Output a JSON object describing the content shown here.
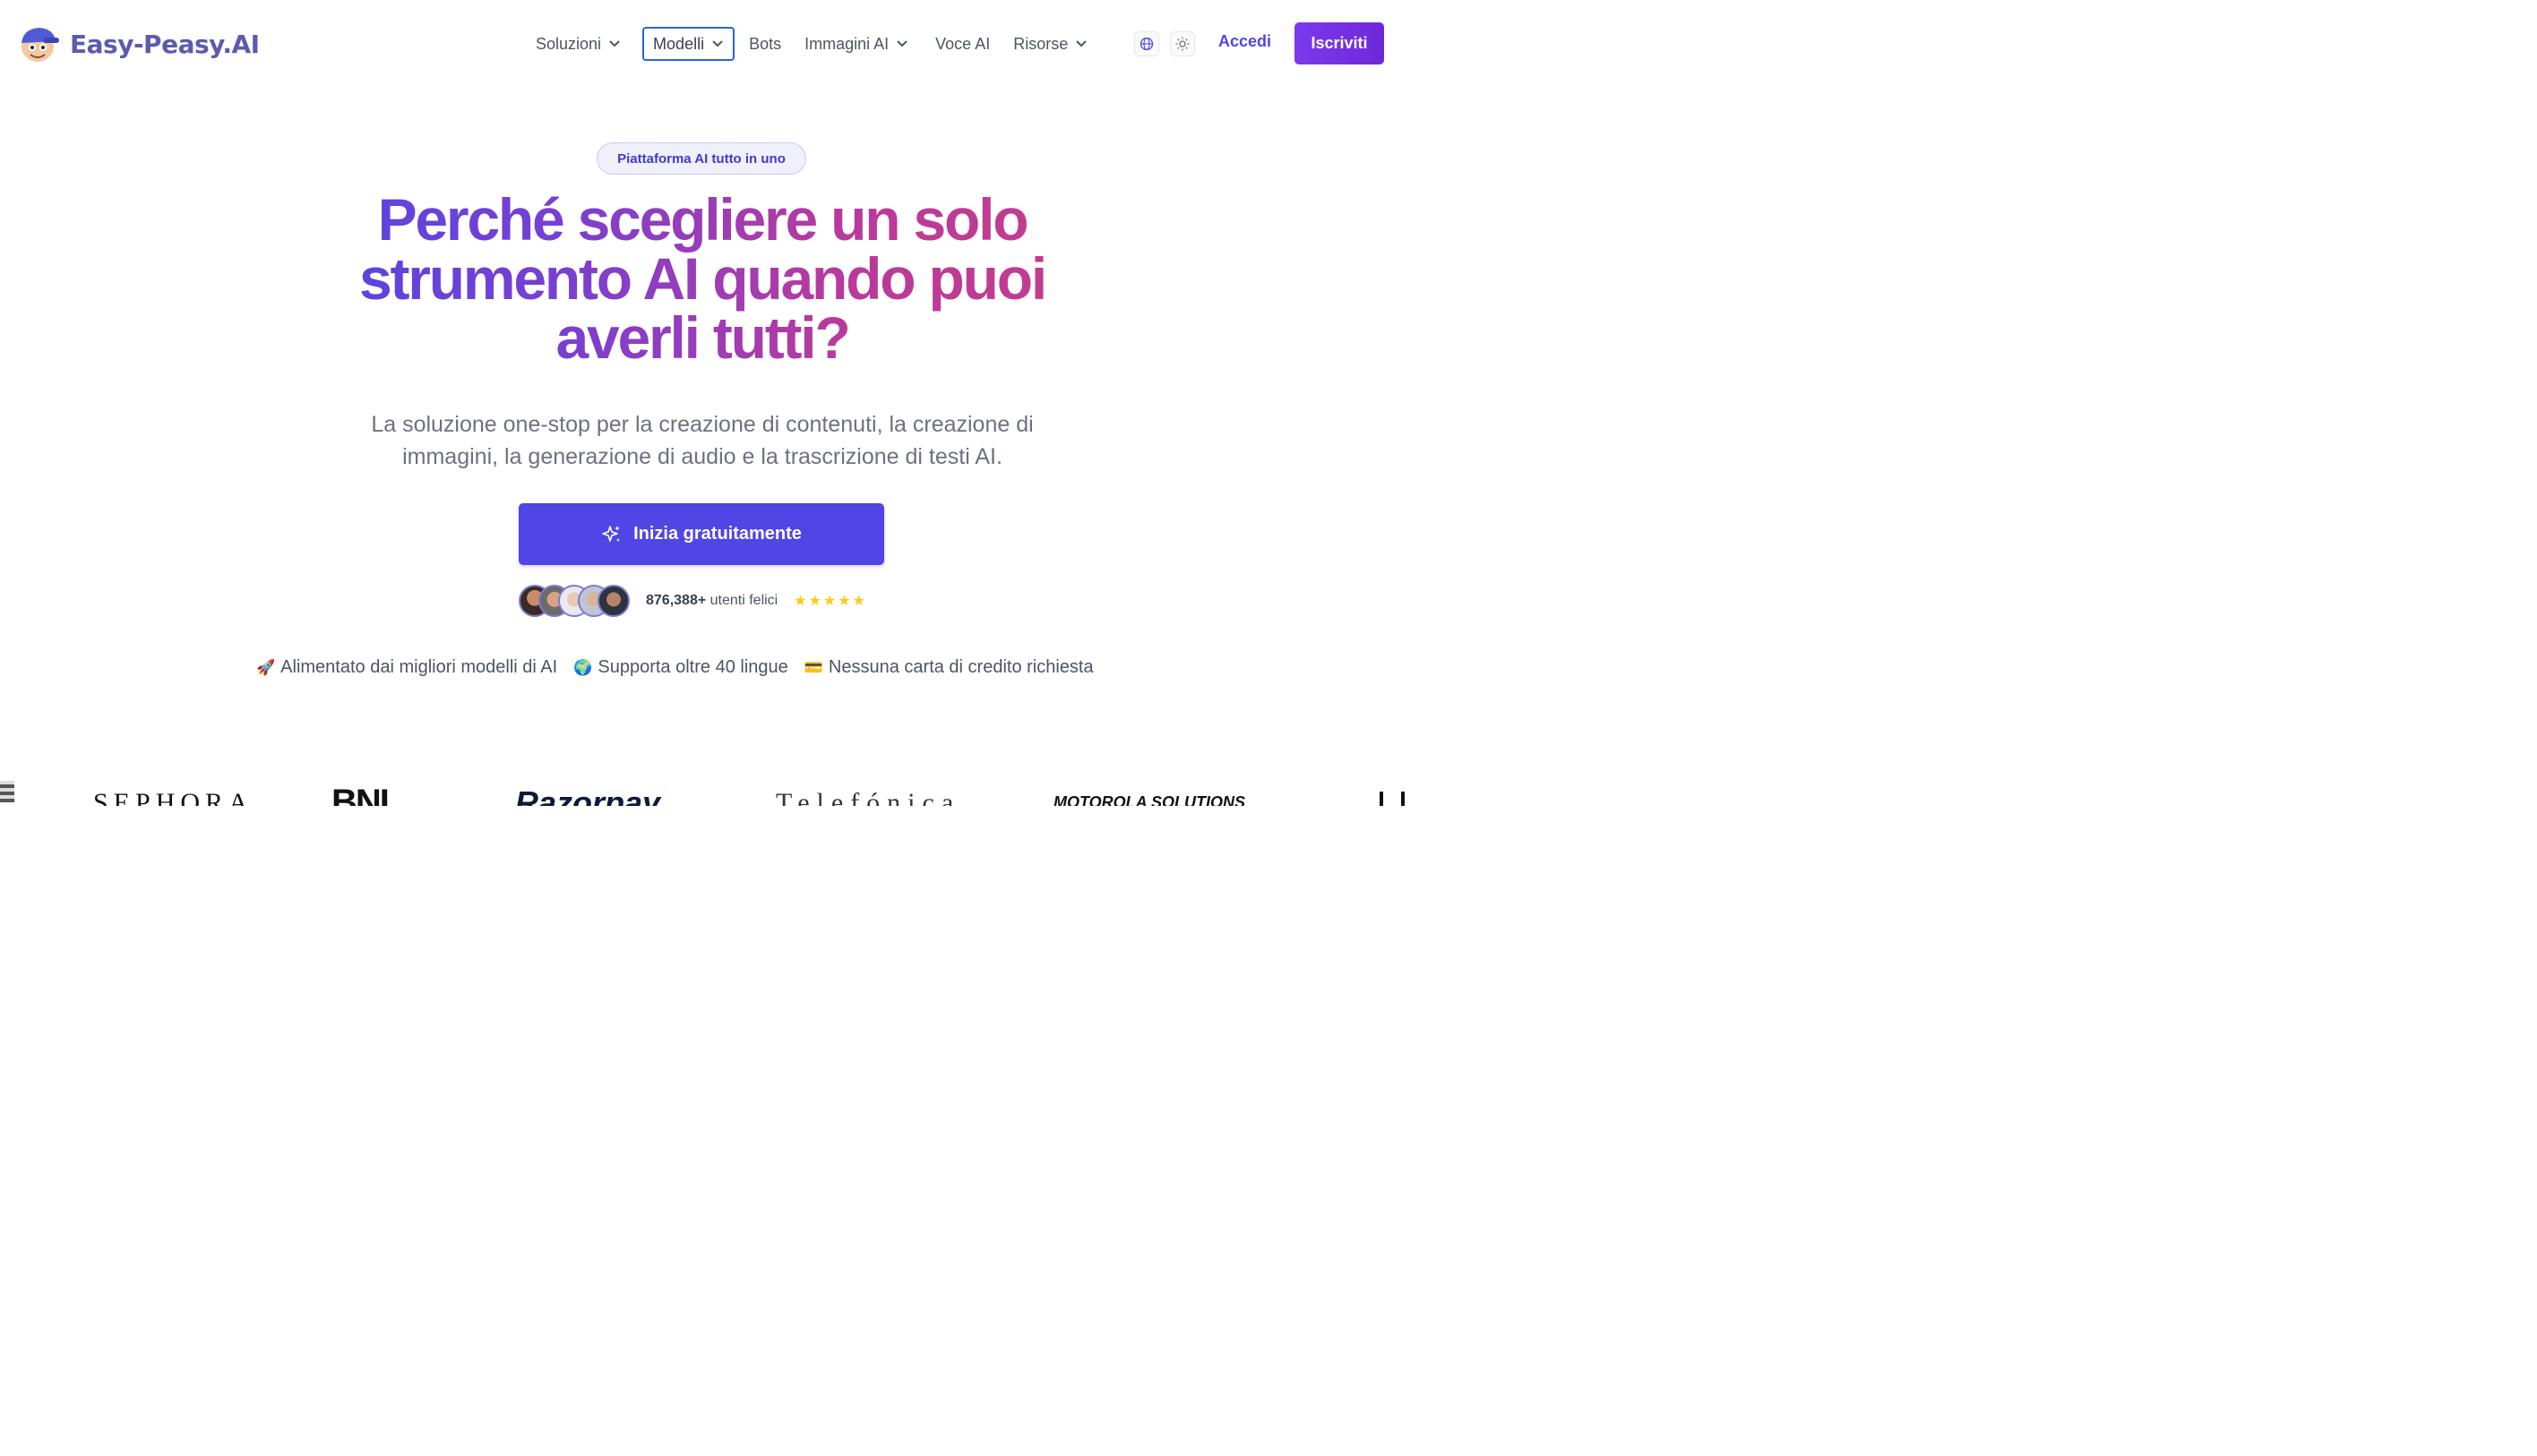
{
  "brand": {
    "name": "Easy-Peasy.AI"
  },
  "nav": {
    "items": [
      {
        "label": "Soluzioni",
        "has_dropdown": true
      },
      {
        "label": "Modelli",
        "has_dropdown": true,
        "focused": true
      },
      {
        "label": "Bots",
        "has_dropdown": false
      },
      {
        "label": "Immagini AI",
        "has_dropdown": true
      },
      {
        "label": "Voce AI",
        "has_dropdown": false
      },
      {
        "label": "Risorse",
        "has_dropdown": true
      }
    ],
    "chevron_glyph": "⌄",
    "language_icon": "globe-icon",
    "theme_icon": "sun-icon",
    "login_label": "Accedi",
    "signup_label": "Iscriviti"
  },
  "hero": {
    "badge": "Piattaforma AI tutto in uno",
    "headline_line1": "Perché scegliere un solo",
    "headline_line2": "strumento AI quando puoi",
    "headline_line3": "averli tutti?",
    "subtitle_line1": "La soluzione one-stop per la creazione di contenuti, la creazione di",
    "subtitle_line2": "immagini, la generazione di audio e la trascrizione di testi AI.",
    "cta_label": "Inizia gratuitamente",
    "cta_icon": "sparkles-icon",
    "users_count": "876,388+",
    "users_label": "utenti felici",
    "rating_stars": 5,
    "stars_text": "★★★★★"
  },
  "features": [
    {
      "emoji": "🚀",
      "label": "Alimentato dai migliori modelli di AI"
    },
    {
      "emoji": "🌍",
      "label": "Supporta oltre 40 lingue"
    },
    {
      "emoji": "💳",
      "label": "Nessuna carta di credito richiesta"
    }
  ],
  "logos": [
    "SEPHORA",
    "BNI",
    "Razorpay",
    "Telefónica",
    "MOTOROLA SOLUTIONS"
  ],
  "colors": {
    "primary": "#4f46e5",
    "signup_bg": "#7c3aed",
    "headline_gradient_start": "#4f46e5",
    "headline_gradient_end": "#c63d87",
    "stars": "#facc15",
    "text_muted": "#6b7280"
  }
}
